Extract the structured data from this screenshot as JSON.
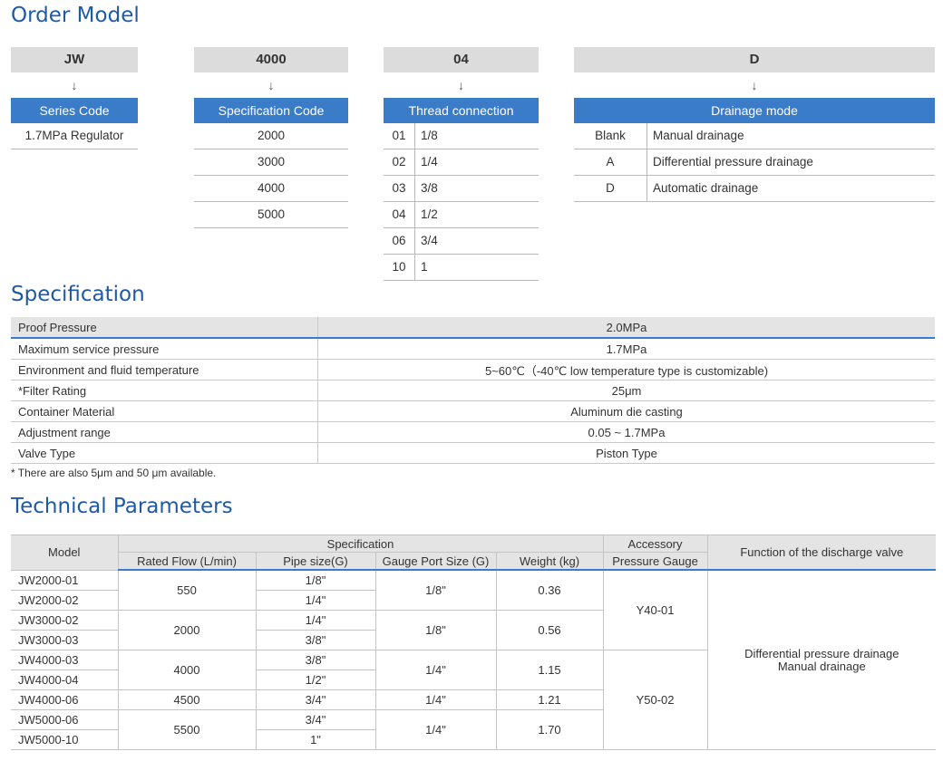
{
  "order_model": {
    "title": "Order Model",
    "arrow": "↓",
    "series": {
      "code": "JW",
      "header": "Series Code",
      "rows": [
        "1.7MPa Regulator"
      ]
    },
    "spec_code": {
      "code": "4000",
      "header": "Specification Code",
      "rows": [
        "2000",
        "3000",
        "4000",
        "5000"
      ]
    },
    "thread": {
      "code": "04",
      "header": "Thread connection",
      "rows": [
        {
          "k": "01",
          "v": "1/8"
        },
        {
          "k": "02",
          "v": "1/4"
        },
        {
          "k": "03",
          "v": "3/8"
        },
        {
          "k": "04",
          "v": "1/2"
        },
        {
          "k": "06",
          "v": "3/4"
        },
        {
          "k": "10",
          "v": "1"
        }
      ]
    },
    "drainage": {
      "code": "D",
      "header": "Drainage mode",
      "rows": [
        {
          "k": "Blank",
          "v": "Manual drainage"
        },
        {
          "k": "A",
          "v": "Differential pressure drainage"
        },
        {
          "k": "D",
          "v": "Automatic drainage"
        }
      ]
    }
  },
  "specification": {
    "title": "Specification",
    "rows": [
      {
        "label": "Proof Pressure",
        "value": "2.0MPa"
      },
      {
        "label": "Maximum service pressure",
        "value": "1.7MPa"
      },
      {
        "label": "Environment and fluid temperature",
        "value": "5~60℃（-40℃ low temperature type is customizable)"
      },
      {
        "label": "*Filter Rating",
        "value": "25μm"
      },
      {
        "label": "Container Material",
        "value": "Aluminum die casting"
      },
      {
        "label": "Adjustment range",
        "value": "0.05 ~ 1.7MPa"
      },
      {
        "label": "Valve Type",
        "value": "Piston Type"
      }
    ],
    "note": "* There are also 5μm and 50 μm available."
  },
  "technical": {
    "title": "Technical Parameters",
    "headers": {
      "model": "Model",
      "specification": "Specification",
      "accessory": "Accessory",
      "function": "Function of the discharge valve",
      "rated_flow": "Rated Flow (L/min)",
      "pipe_size": "Pipe size(G)",
      "gauge_port": "Gauge Port Size (G)",
      "weight": "Weight (kg)",
      "pressure_gauge": "Pressure Gauge"
    },
    "models": [
      "JW2000-01",
      "JW2000-02",
      "JW3000-02",
      "JW3000-03",
      "JW4000-03",
      "JW4000-04",
      "JW4000-06",
      "JW5000-06",
      "JW5000-10"
    ],
    "pipe_sizes": [
      "1/8\"",
      "1/4\"",
      "1/4\"",
      "3/8\"",
      "3/8\"",
      "1/2\"",
      "3/4\"",
      "3/4\"",
      "1\""
    ],
    "flows": [
      "550",
      "2000",
      "4000",
      "4500",
      "5500"
    ],
    "gauge_ports": [
      "1/8\"",
      "1/8\"",
      "1/4\"",
      "1/4\"",
      "1/4\""
    ],
    "weights": [
      "0.36",
      "0.56",
      "1.15",
      "1.21",
      "1.70"
    ],
    "gauges": [
      "Y40-01",
      "Y50-02"
    ],
    "function_lines": [
      "Differential pressure drainage",
      "Manual drainage"
    ]
  }
}
